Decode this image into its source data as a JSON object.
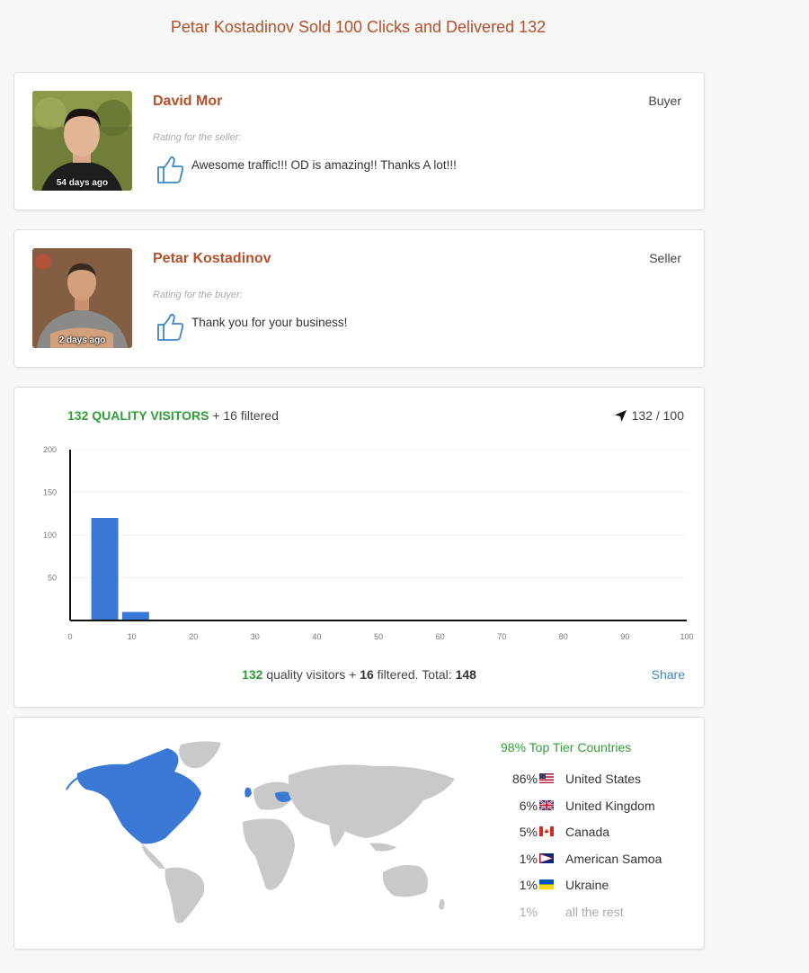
{
  "page": {
    "title": "Petar Kostadinov Sold 100 Clicks and Delivered 132"
  },
  "reviews": [
    {
      "name": "David Mor",
      "role": "Buyer",
      "rating_label": "Rating for the seller:",
      "text": "Awesome traffic!!! OD is amazing!! Thanks A lot!!!",
      "ago": "54 days ago",
      "rating_icon": "thumbs-up-icon"
    },
    {
      "name": "Petar Kostadinov",
      "role": "Seller",
      "rating_label": "Rating for the buyer:",
      "text": "Thank you for your business!",
      "ago": "2 days ago",
      "rating_icon": "thumbs-up-icon"
    }
  ],
  "stats": {
    "quality_label": "132 QUALITY VISITORS",
    "filtered_label": "+ 16 filtered",
    "goal_icon": "location-arrow-icon",
    "goal": "132 / 100",
    "summary_quality": "132",
    "summary_text1": "quality visitors +",
    "summary_filtered": "16",
    "summary_text2": "filtered. Total:",
    "summary_total": "148",
    "share_label": "Share"
  },
  "chart_data": {
    "type": "bar",
    "x": [
      5,
      10
    ],
    "values": [
      120,
      10
    ],
    "bar_width": 4.3,
    "xlim": [
      0,
      100
    ],
    "ylim": [
      0,
      200
    ],
    "xticks": [
      0,
      10,
      20,
      30,
      40,
      50,
      60,
      70,
      80,
      90,
      100
    ],
    "yticks": [
      50,
      100,
      150,
      200
    ],
    "grid": true,
    "color": "#3a78d6"
  },
  "geo": {
    "tier_label": "98% Top Tier Countries",
    "highlight_color": "#3a78d6",
    "countries": [
      {
        "pct": "86%",
        "name": "United States",
        "flag": "us-flag-icon"
      },
      {
        "pct": "6%",
        "name": "United Kingdom",
        "flag": "uk-flag-icon"
      },
      {
        "pct": "5%",
        "name": "Canada",
        "flag": "canada-flag-icon"
      },
      {
        "pct": "1%",
        "name": "American Samoa",
        "flag": "american-samoa-flag-icon"
      },
      {
        "pct": "1%",
        "name": "Ukraine",
        "flag": "ukraine-flag-icon"
      }
    ],
    "rest": {
      "pct": "1%",
      "name": "all the rest"
    }
  }
}
